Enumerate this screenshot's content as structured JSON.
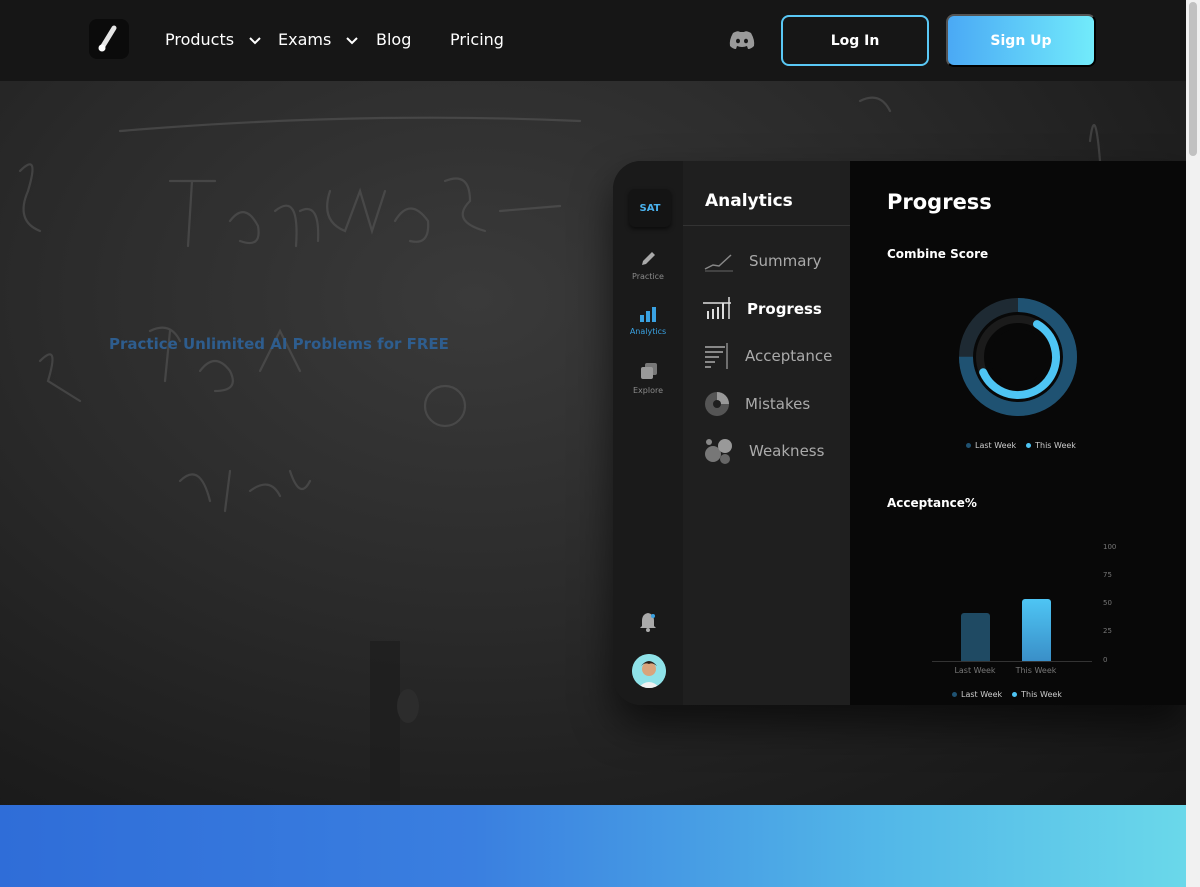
{
  "nav": {
    "items": [
      {
        "label": "Products",
        "has_dropdown": true
      },
      {
        "label": "Exams",
        "has_dropdown": true
      },
      {
        "label": "Blog",
        "has_dropdown": false
      },
      {
        "label": "Pricing",
        "has_dropdown": false
      }
    ],
    "login_label": "Log In",
    "signup_label": "Sign Up",
    "discord_icon": "discord-icon"
  },
  "hero": {
    "tagline": "Practice Unlimited AI Problems for FREE"
  },
  "app": {
    "exam_badge": "SAT",
    "rail": [
      {
        "label": "Practice",
        "icon": "pencil-icon"
      },
      {
        "label": "Analytics",
        "icon": "bar-chart-icon",
        "active": true
      },
      {
        "label": "Explore",
        "icon": "cards-icon"
      }
    ],
    "section_title": "Analytics",
    "menu": [
      {
        "label": "Summary",
        "icon": "trend-icon"
      },
      {
        "label": "Progress",
        "icon": "bars-icon",
        "active": true
      },
      {
        "label": "Acceptance",
        "icon": "list-icon"
      },
      {
        "label": "Mistakes",
        "icon": "pie-icon"
      },
      {
        "label": "Weakness",
        "icon": "bubbles-icon"
      }
    ],
    "panel_title": "Progress",
    "combine_score_title": "Combine Score",
    "acceptance_title": "Acceptance%",
    "legend": {
      "last_week": "Last Week",
      "this_week": "This Week"
    }
  },
  "colors": {
    "last_week": "#1f5272",
    "this_week": "#4ec5f4",
    "accent": "#5ac8f5"
  },
  "chart_data": [
    {
      "type": "pie",
      "title": "Combine Score",
      "series": [
        {
          "name": "Last Week",
          "value": 0.75
        },
        {
          "name": "This Week",
          "value": 0.6
        }
      ]
    },
    {
      "type": "bar",
      "title": "Acceptance%",
      "categories": [
        "Last Week",
        "This Week"
      ],
      "values": [
        42,
        54
      ],
      "ylim": [
        0,
        100
      ],
      "yticks": [
        "100",
        "75",
        "50",
        "25",
        "0"
      ]
    }
  ]
}
